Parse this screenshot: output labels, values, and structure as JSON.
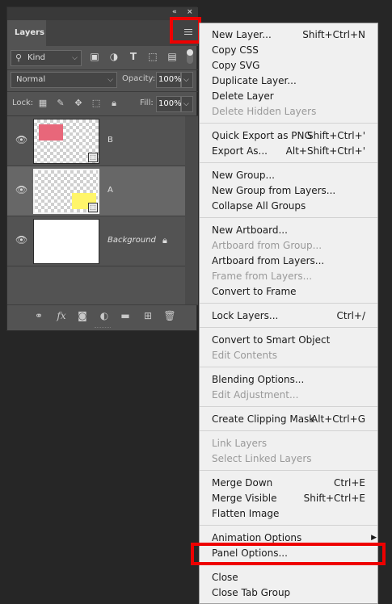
{
  "panel": {
    "tab_label": "Layers",
    "collapse_glyph": "«",
    "close_glyph": "×",
    "filter": {
      "kind_label": "Kind",
      "kind_icon": "search-icon"
    },
    "blend": {
      "mode": "Normal",
      "opacity_label": "Opacity:",
      "opacity_value": "100%"
    },
    "lock": {
      "label": "Lock:",
      "fill_label": "Fill:",
      "fill_value": "100%"
    },
    "layers": [
      {
        "name": "B",
        "thumb_color": "#e8677a",
        "visible": true,
        "selected": false
      },
      {
        "name": "A",
        "thumb_color": "#fff56a",
        "visible": true,
        "selected": true
      },
      {
        "name": "Background",
        "visible": true,
        "locked": true,
        "italic": true
      }
    ],
    "bottom_icons": [
      "link-icon",
      "fx-icon",
      "mask-icon",
      "adjustment-icon",
      "folder-icon",
      "new-layer-icon",
      "trash-icon"
    ],
    "fx_label": "fx"
  },
  "menu": {
    "groups": [
      [
        {
          "label": "New Layer...",
          "shortcut": "Shift+Ctrl+N",
          "enabled": true
        },
        {
          "label": "Copy CSS",
          "shortcut": "",
          "enabled": true
        },
        {
          "label": "Copy SVG",
          "shortcut": "",
          "enabled": true
        },
        {
          "label": "Duplicate Layer...",
          "shortcut": "",
          "enabled": true
        },
        {
          "label": "Delete Layer",
          "shortcut": "",
          "enabled": true
        },
        {
          "label": "Delete Hidden Layers",
          "shortcut": "",
          "enabled": false
        }
      ],
      [
        {
          "label": "Quick Export as PNG",
          "shortcut": "Shift+Ctrl+'",
          "enabled": true
        },
        {
          "label": "Export As...",
          "shortcut": "Alt+Shift+Ctrl+'",
          "enabled": true
        }
      ],
      [
        {
          "label": "New Group...",
          "shortcut": "",
          "enabled": true
        },
        {
          "label": "New Group from Layers...",
          "shortcut": "",
          "enabled": true
        },
        {
          "label": "Collapse All Groups",
          "shortcut": "",
          "enabled": true
        }
      ],
      [
        {
          "label": "New Artboard...",
          "shortcut": "",
          "enabled": true
        },
        {
          "label": "Artboard from Group...",
          "shortcut": "",
          "enabled": false
        },
        {
          "label": "Artboard from Layers...",
          "shortcut": "",
          "enabled": true
        },
        {
          "label": "Frame from Layers...",
          "shortcut": "",
          "enabled": false
        },
        {
          "label": "Convert to Frame",
          "shortcut": "",
          "enabled": true
        }
      ],
      [
        {
          "label": "Lock Layers...",
          "shortcut": "Ctrl+/",
          "enabled": true
        }
      ],
      [
        {
          "label": "Convert to Smart Object",
          "shortcut": "",
          "enabled": true
        },
        {
          "label": "Edit Contents",
          "shortcut": "",
          "enabled": false
        }
      ],
      [
        {
          "label": "Blending Options...",
          "shortcut": "",
          "enabled": true
        },
        {
          "label": "Edit Adjustment...",
          "shortcut": "",
          "enabled": false
        }
      ],
      [
        {
          "label": "Create Clipping Mask",
          "shortcut": "Alt+Ctrl+G",
          "enabled": true
        }
      ],
      [
        {
          "label": "Link Layers",
          "shortcut": "",
          "enabled": false
        },
        {
          "label": "Select Linked Layers",
          "shortcut": "",
          "enabled": false
        }
      ],
      [
        {
          "label": "Merge Down",
          "shortcut": "Ctrl+E",
          "enabled": true
        },
        {
          "label": "Merge Visible",
          "shortcut": "Shift+Ctrl+E",
          "enabled": true
        },
        {
          "label": "Flatten Image",
          "shortcut": "",
          "enabled": true
        }
      ],
      [
        {
          "label": "Animation Options",
          "shortcut": "",
          "enabled": true,
          "submenu": true
        },
        {
          "label": "Panel Options...",
          "shortcut": "",
          "enabled": true,
          "highlighted": true
        }
      ],
      [
        {
          "label": "Close",
          "shortcut": "",
          "enabled": true
        },
        {
          "label": "Close Tab Group",
          "shortcut": "",
          "enabled": true
        }
      ]
    ]
  },
  "highlight_color": "#ee0000"
}
